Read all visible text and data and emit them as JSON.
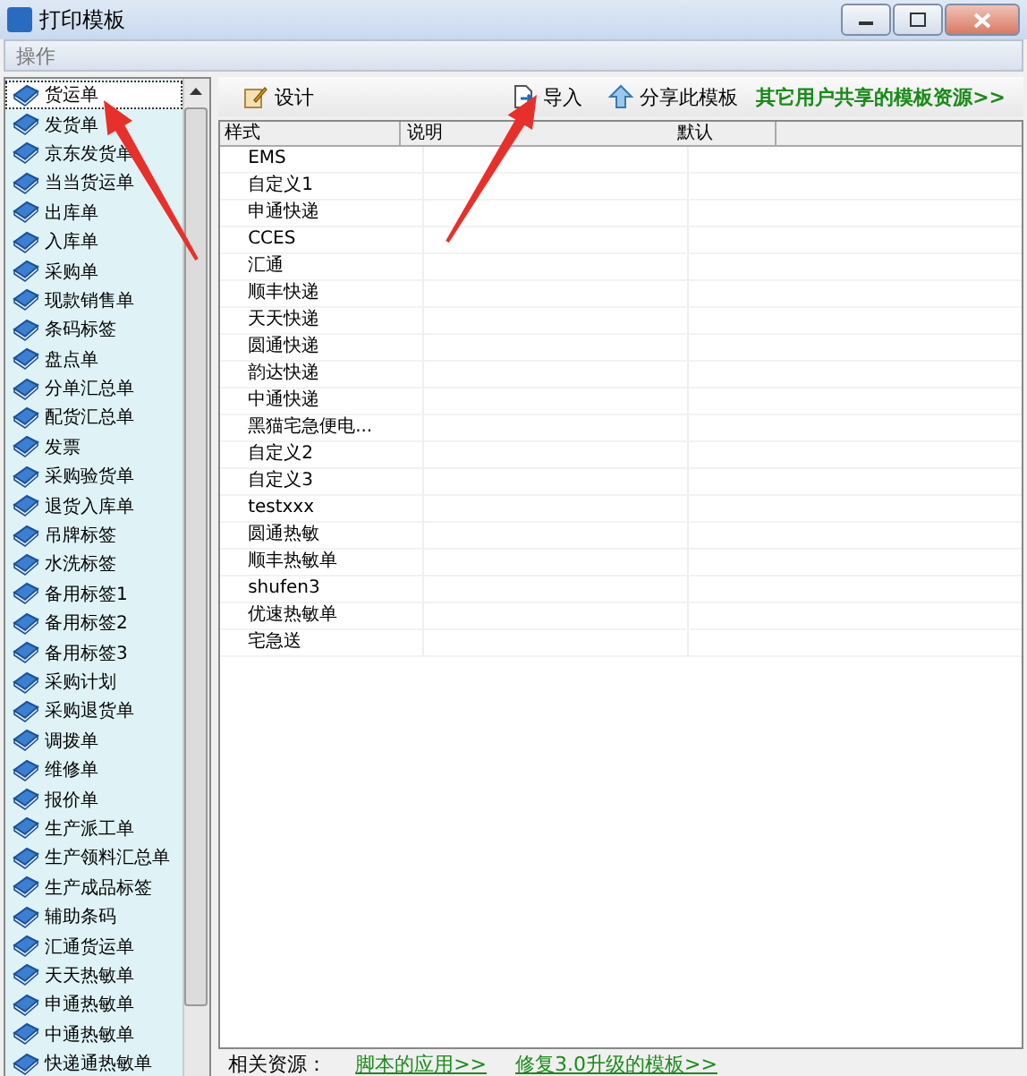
{
  "window": {
    "title": "打印模板"
  },
  "section_header": "操作",
  "sidebar": {
    "items": [
      {
        "label": "货运单",
        "selected": true
      },
      {
        "label": "发货单",
        "selected": false
      },
      {
        "label": "京东发货单",
        "selected": false
      },
      {
        "label": "当当货运单",
        "selected": false
      },
      {
        "label": "出库单",
        "selected": false
      },
      {
        "label": "入库单",
        "selected": false
      },
      {
        "label": "采购单",
        "selected": false
      },
      {
        "label": "现款销售单",
        "selected": false
      },
      {
        "label": "条码标签",
        "selected": false
      },
      {
        "label": "盘点单",
        "selected": false
      },
      {
        "label": "分单汇总单",
        "selected": false
      },
      {
        "label": "配货汇总单",
        "selected": false
      },
      {
        "label": "发票",
        "selected": false
      },
      {
        "label": "采购验货单",
        "selected": false
      },
      {
        "label": "退货入库单",
        "selected": false
      },
      {
        "label": "吊牌标签",
        "selected": false
      },
      {
        "label": "水洗标签",
        "selected": false
      },
      {
        "label": "备用标签1",
        "selected": false
      },
      {
        "label": "备用标签2",
        "selected": false
      },
      {
        "label": "备用标签3",
        "selected": false
      },
      {
        "label": "采购计划",
        "selected": false
      },
      {
        "label": "采购退货单",
        "selected": false
      },
      {
        "label": "调拨单",
        "selected": false
      },
      {
        "label": "维修单",
        "selected": false
      },
      {
        "label": "报价单",
        "selected": false
      },
      {
        "label": "生产派工单",
        "selected": false
      },
      {
        "label": "生产领料汇总单",
        "selected": false
      },
      {
        "label": "生产成品标签",
        "selected": false
      },
      {
        "label": "辅助条码",
        "selected": false
      },
      {
        "label": "汇通货运单",
        "selected": false
      },
      {
        "label": "天天热敏单",
        "selected": false
      },
      {
        "label": "申通热敏单",
        "selected": false
      },
      {
        "label": "中通热敏单",
        "selected": false
      },
      {
        "label": "快递通热敏单",
        "selected": false
      }
    ]
  },
  "toolbar": {
    "buttons": [
      {
        "kind": "design",
        "label": "设计"
      },
      {
        "kind": "import",
        "label": "导入"
      },
      {
        "kind": "share",
        "label": "分享此模板"
      }
    ],
    "link": "其它用户共享的模板资源>>"
  },
  "table": {
    "columns": [
      "样式",
      "说明",
      "默认"
    ],
    "rows": [
      "EMS",
      "自定义1",
      "申通快递",
      "CCES",
      "汇通",
      "顺丰快递",
      "天天快递",
      "圆通快递",
      "韵达快递",
      "中通快递",
      "黑猫宅急便电...",
      "自定义2",
      "自定义3",
      "testxxx",
      "圆通热敏",
      "顺丰热敏单",
      "shufen3",
      "优速热敏单",
      "宅急送"
    ]
  },
  "footer": {
    "label": "相关资源：",
    "links": [
      "脚本的应用>>",
      "修复3.0升级的模板>>"
    ]
  }
}
